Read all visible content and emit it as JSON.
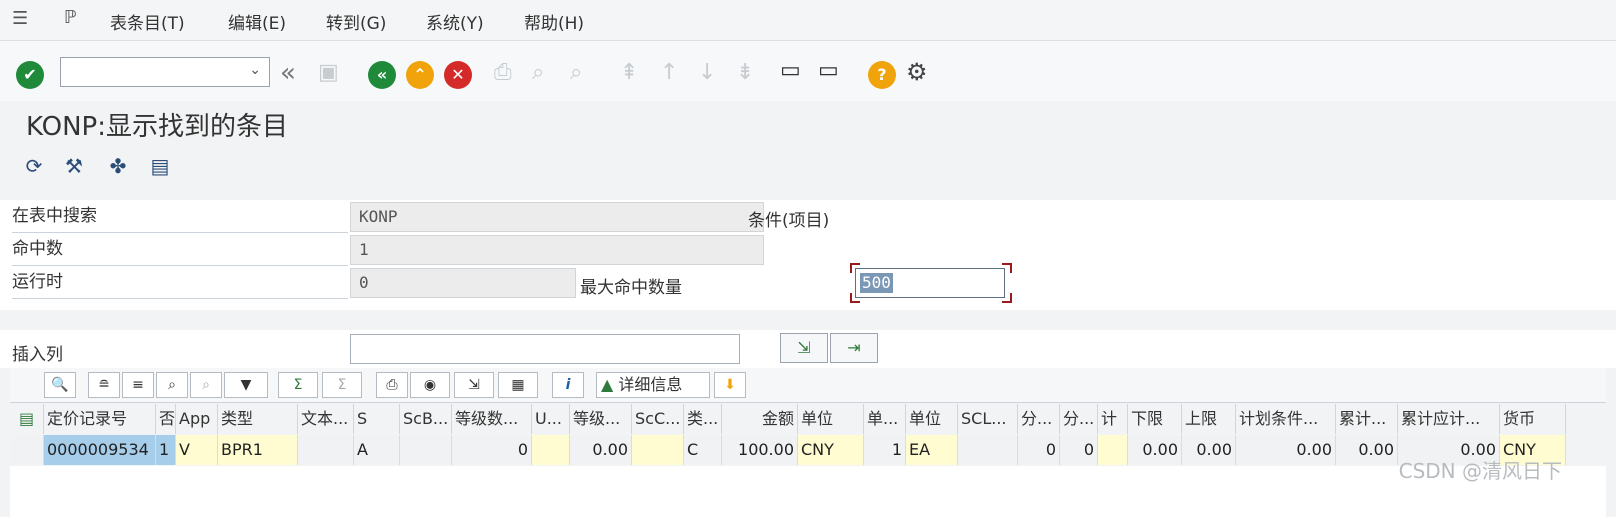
{
  "menu": {
    "items": [
      "表条目(T)",
      "编辑(E)",
      "转到(G)",
      "系统(Y)",
      "帮助(H)"
    ]
  },
  "toolbar": {
    "command_value": ""
  },
  "title": "KONP:显示找到的条目",
  "form": {
    "search_table_label": "在表中搜索",
    "search_table_value": "KONP",
    "search_table_desc": "条件(项目)",
    "hits_label": "命中数",
    "hits_value": "1",
    "runtime_label": "运行时",
    "runtime_value": "0",
    "max_hits_label": "最大命中数量",
    "max_hits_value": "500",
    "insert_col_label": "插入列",
    "insert_col_value": ""
  },
  "gridtoolbar": {
    "detail_label": "详细信息"
  },
  "table": {
    "headers": [
      "定价记录号",
      "否",
      "App",
      "类型",
      "文本...",
      "S",
      "ScB...",
      "等级数...",
      "U...",
      "等级...",
      "ScC...",
      "类...",
      "金额",
      "单位",
      "单...",
      "单位",
      "SCL...",
      "分...",
      "分...",
      "计",
      "下限",
      "上限",
      "计划条件...",
      "累计...",
      "累计应计...",
      "货币"
    ],
    "row": [
      "0000009534",
      "1",
      "V",
      "BPR1",
      "",
      "A",
      "",
      "0",
      "",
      "0.00",
      "",
      "C",
      "100.00",
      "CNY",
      "1",
      "EA",
      "",
      "0",
      "0",
      "",
      "0.00",
      "0.00",
      "0.00",
      "0.00",
      "0.00",
      "CNY"
    ]
  },
  "watermark": "CSDN @清风日下",
  "colors": {
    "green": "#1f8a3a",
    "amber": "#f0a30a",
    "red": "#d42a2a",
    "key": "#a6cde9",
    "input_yellow": "#fffcd1"
  }
}
